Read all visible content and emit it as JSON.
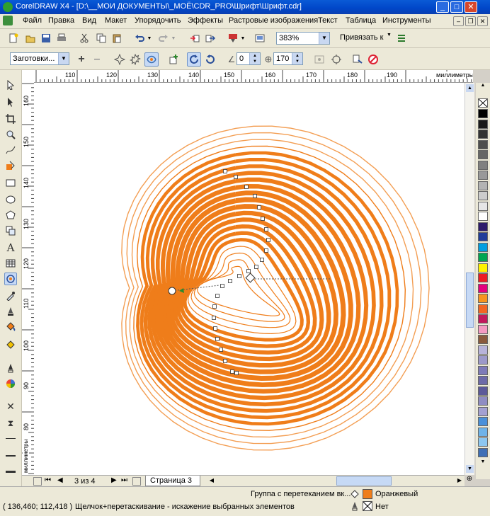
{
  "window": {
    "title": "CorelDRAW X4 - [D:\\__МОИ ДОКУМЕНТЫ\\_МОЁ\\CDR_PRO\\Шрифт\\Шрифт.cdr]",
    "icon": "coreldraw-app-icon",
    "buttons": {
      "minimize": "_",
      "maximize": "□",
      "close": "✕"
    }
  },
  "menu": {
    "items": [
      "Файл",
      "Правка",
      "Вид",
      "Макет",
      "Упорядочить",
      "Эффекты",
      "Растровые изображения",
      "Текст",
      "Таблица",
      "Инструменты"
    ],
    "doc_buttons": {
      "minimize": "–",
      "restore": "❐",
      "close": "✕"
    }
  },
  "toolbar1": {
    "zoom": "383%",
    "snap_label": "Привязать к"
  },
  "toolbar2": {
    "presets": "Заготовки...",
    "angle": "0",
    "amplitude": "170"
  },
  "rulers": {
    "units": "миллиметры",
    "h_ticks": [
      "110",
      "120",
      "130",
      "140",
      "150",
      "160",
      "170",
      "180",
      "190"
    ],
    "v_ticks": [
      "160",
      "150",
      "140",
      "130",
      "120",
      "110",
      "100",
      "90",
      "80"
    ],
    "v_units": "миллиметры"
  },
  "palette": {
    "colors": [
      "#000000",
      "#1a1a1a",
      "#333333",
      "#4d4d4d",
      "#666666",
      "#808080",
      "#999999",
      "#b3b3b3",
      "#cccccc",
      "#e6e6e6",
      "#ffffff",
      "#2d1b6b",
      "#1f3c99",
      "#009ee0",
      "#00a651",
      "#fff200",
      "#ed1c24",
      "#e4007c",
      "#f7941d",
      "#f26522",
      "#c2185b",
      "#f49ac1",
      "#8a5a3c",
      "#b7b3d9",
      "#9c99c9",
      "#7e7bb8",
      "#6d6aa8",
      "#5c5999",
      "#8f8cc2",
      "#a3a0d1",
      "#4a90d9",
      "#6fb3e8",
      "#8dc7f0",
      "#3f6fb5"
    ]
  },
  "pagebar": {
    "page_count": "3 из 4",
    "page_tab": "Страница 3"
  },
  "status": {
    "coords": "( 136,460; 112,418 )",
    "hint": "Щелчок+перетаскивание - искажение выбранных элементов",
    "object": "Группа с перетеканием вк...",
    "fill_name": "Оранжевый",
    "fill_color": "#ef7d1a",
    "outline_name": "Нет"
  },
  "drawing": {
    "accent": "#ef7d1a"
  }
}
